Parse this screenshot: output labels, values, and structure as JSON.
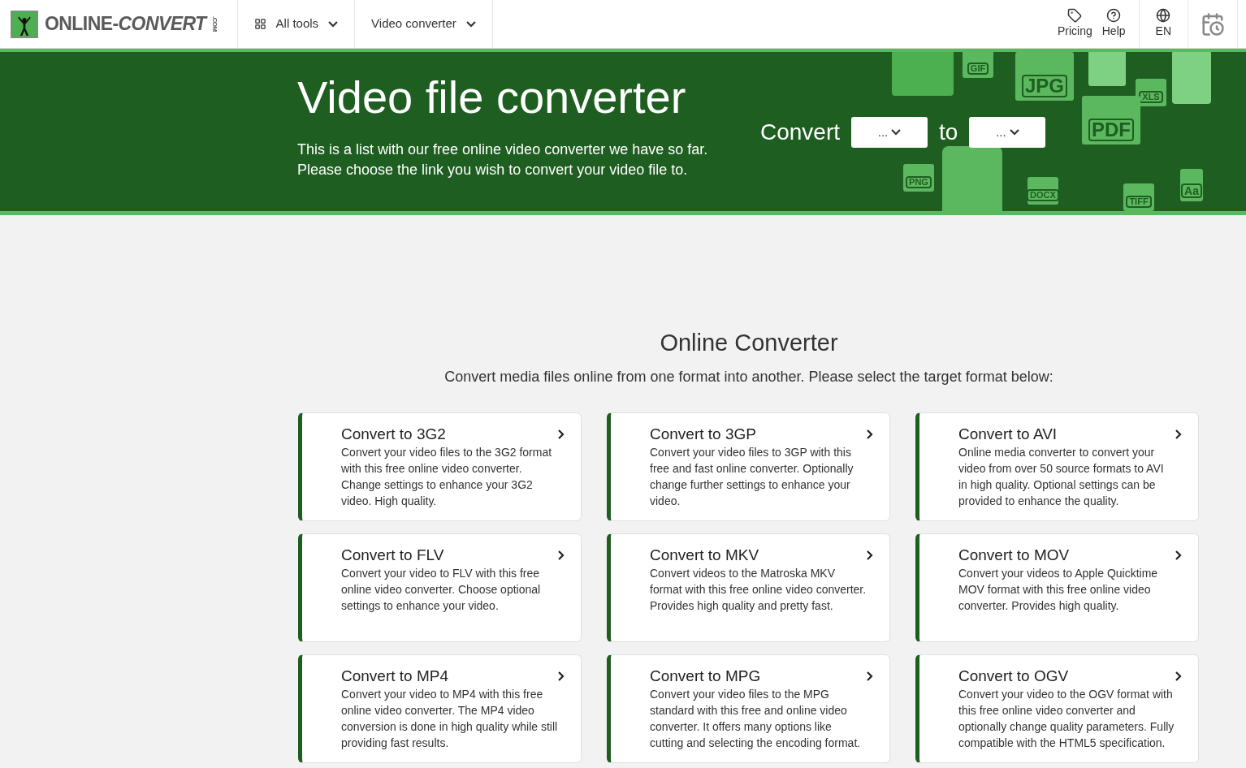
{
  "header": {
    "logo": {
      "name": "ONLINE-",
      "accent": "CONVERT",
      "suffix": ".COM"
    },
    "nav": [
      {
        "label": "All tools",
        "kind": "tools"
      },
      {
        "label": "Video converter",
        "kind": "plain"
      }
    ],
    "actions": [
      {
        "label": "Pricing",
        "kind": "tag"
      },
      {
        "label": "Help",
        "kind": "help"
      }
    ],
    "language": "EN"
  },
  "hero": {
    "title": "Video file converter",
    "lines": [
      "This is a list with our free online video converter we have so far.",
      "Please choose the link you wish to convert your video file to."
    ],
    "convert_label": "Convert",
    "from_value": "...",
    "to_label": "to",
    "to_value": "...",
    "file_icons": [
      {
        "label": "GIF",
        "kind": "small"
      },
      {
        "label": "JPG",
        "kind": "large"
      },
      {
        "label": "XLS",
        "kind": "small"
      },
      {
        "label": "PDF",
        "kind": "large"
      },
      {
        "label": "PNG",
        "kind": "small"
      },
      {
        "label": "DOCX",
        "kind": "small"
      },
      {
        "label": "TIFF",
        "kind": "small"
      },
      {
        "label": "Aa",
        "kind": "medium"
      }
    ]
  },
  "section": {
    "title": "Online Converter",
    "subtitle": "Convert media files online from one format into another. Please select the target format below:"
  },
  "cards": [
    {
      "title": "Convert to 3G2",
      "text": "Convert your video files to the 3G2 format with this free online video converter. Change settings to enhance your 3G2 video. High quality."
    },
    {
      "title": "Convert to 3GP",
      "text": "Convert your video files to 3GP with this free and fast online converter. Optionally change further settings to enhance your video."
    },
    {
      "title": "Convert to AVI",
      "text": "Online media converter to convert your video from over 50 source formats to AVI in high quality. Optional settings can be provided to enhance the quality."
    },
    {
      "title": "Convert to FLV",
      "text": "Convert your video to FLV with this free online video converter. Choose optional settings to enhance your video."
    },
    {
      "title": "Convert to MKV",
      "text": "Convert videos to the Matroska MKV format with this free online video converter. Provides high quality and pretty fast."
    },
    {
      "title": "Convert to MOV",
      "text": "Convert your videos to Apple Quicktime MOV format with this free online video converter. Provides high quality."
    },
    {
      "title": "Convert to MP4",
      "text": "Convert your video to MP4 with this free online video converter. The MP4 video conversion is done in high quality while still providing fast results."
    },
    {
      "title": "Convert to MPG",
      "text": "Convert your video files to the MPG standard with this free and online video converter. It offers many options like cutting and selecting the encoding format."
    },
    {
      "title": "Convert to OGV",
      "text": "Convert your video to the OGV format with this free online video converter and optionally change quality parameters. Fully compatible with the HTML5 specification."
    }
  ]
}
